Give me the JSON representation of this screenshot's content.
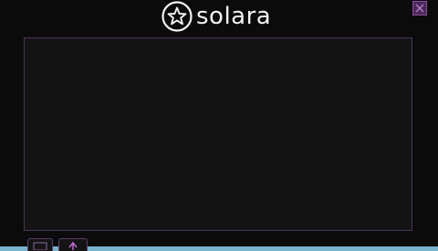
{
  "app": {
    "title": "solara",
    "logo_icon": "star-in-circle-icon"
  },
  "titlebar": {
    "close_icon": "close-icon"
  },
  "editor": {
    "content": ""
  },
  "bottom_bar": {
    "buttons": [
      {
        "name": "execute-button",
        "icon": "code-icon"
      },
      {
        "name": "clear-button",
        "icon": "upload-icon"
      }
    ]
  },
  "colors": {
    "window_bg": "#0b0b0c",
    "editor_bg": "#141414",
    "accent_border": "#5a3d66",
    "text": "#f2f2f2"
  }
}
